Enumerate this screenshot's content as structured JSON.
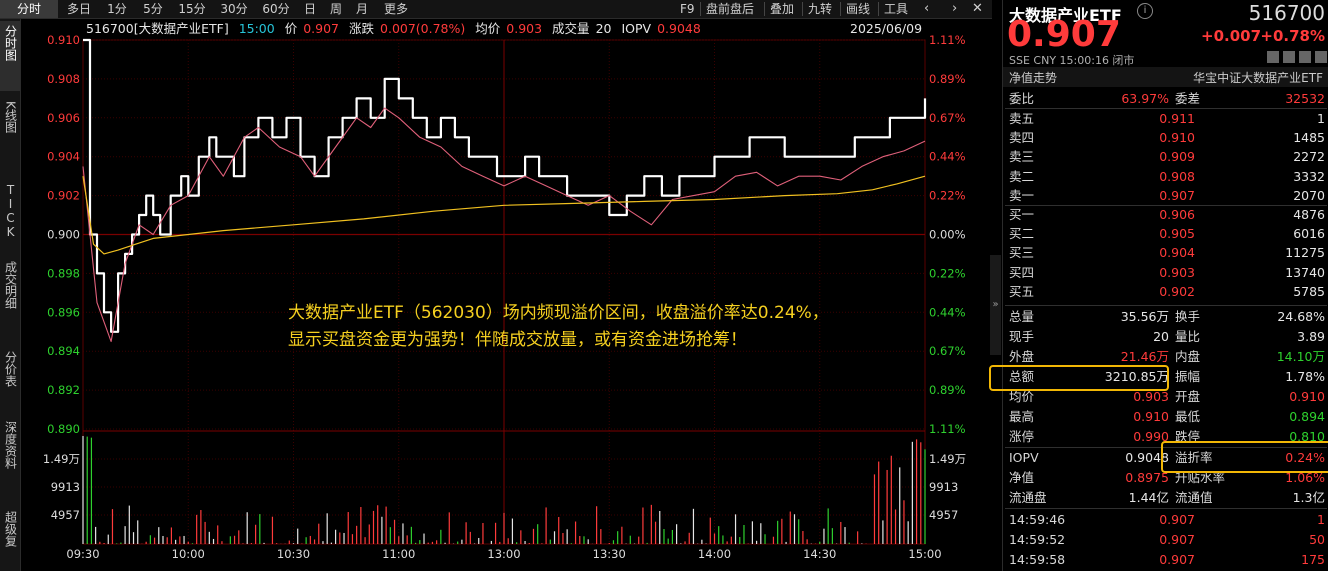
{
  "topbar": {
    "tabs": [
      "分时",
      "多日",
      "1分",
      "5分",
      "15分",
      "30分",
      "60分",
      "日",
      "周",
      "月",
      "更多"
    ],
    "tools": [
      "F9",
      "盘前盘后",
      "叠加",
      "九转",
      "画线",
      "工具"
    ]
  },
  "leftbar": {
    "tabs": [
      "分时图",
      "K线图",
      "TICK",
      "成交明细",
      "分价表",
      "深度资料",
      "超级复"
    ]
  },
  "info": {
    "code_name": "516700[大数据产业ETF]",
    "time": "15:00",
    "price_label": "价",
    "price": "0.907",
    "change_label": "涨跌",
    "change": "0.007(0.78%)",
    "avg_label": "均价",
    "avg": "0.903",
    "vol_label": "成交量",
    "vol": "20",
    "iopv_label": "IOPV",
    "iopv": "0.9048",
    "date": "2025/06/09"
  },
  "annotation": {
    "line1": "大数据产业ETF（562030）场内频现溢价区间，收盘溢价率达0.24%，",
    "line2": "显示买盘资金更为强势！伴随成交放量，或有资金进场抢筹！"
  },
  "chart_data": {
    "type": "line",
    "x_ticks": [
      "09:30",
      "10:00",
      "10:30",
      "11:00",
      "13:00",
      "13:30",
      "14:00",
      "14:30",
      "15:00"
    ],
    "y_ticks": [
      "0.910",
      "0.908",
      "0.906",
      "0.904",
      "0.902",
      "0.900",
      "0.898",
      "0.896",
      "0.894",
      "0.892",
      "0.890"
    ],
    "pct_ticks": [
      "1.11%",
      "0.89%",
      "0.67%",
      "0.44%",
      "0.22%",
      "0.00%",
      "0.22%",
      "0.44%",
      "0.67%",
      "0.89%",
      "1.11%"
    ],
    "ylim": [
      0.89,
      0.91
    ],
    "vol_ticks": [
      "1.49万",
      "9913",
      "4957"
    ],
    "vol_ylim": [
      0,
      20000
    ],
    "colors": {
      "price": "#ffffff",
      "nav": "#e0607a",
      "avg": "#f0c020",
      "up": "#ff3b3b",
      "down": "#2ed12e",
      "grid": "#3a0000"
    },
    "series": [
      {
        "name": "价",
        "x": [
          0,
          2,
          4,
          6,
          8,
          10,
          12,
          14,
          16,
          18,
          20,
          22,
          25,
          28,
          30,
          33,
          36,
          38,
          40,
          43,
          46,
          50,
          54,
          58,
          62,
          66,
          70,
          74,
          78,
          82,
          86,
          90,
          94,
          98,
          102,
          106,
          110,
          114,
          118,
          122,
          126,
          130,
          134,
          138,
          142,
          146,
          150,
          155,
          160,
          165,
          170,
          175,
          180,
          185,
          190,
          195,
          200,
          205,
          210,
          215,
          220,
          225,
          230,
          235,
          240
        ],
        "values": [
          0.91,
          0.9,
          0.898,
          0.896,
          0.895,
          0.898,
          0.899,
          0.9,
          0.901,
          0.902,
          0.901,
          0.9,
          0.902,
          0.903,
          0.902,
          0.904,
          0.905,
          0.904,
          0.904,
          0.903,
          0.905,
          0.906,
          0.905,
          0.906,
          0.904,
          0.903,
          0.905,
          0.906,
          0.907,
          0.906,
          0.908,
          0.907,
          0.906,
          0.905,
          0.906,
          0.905,
          0.904,
          0.904,
          0.903,
          0.903,
          0.904,
          0.903,
          0.903,
          0.902,
          0.902,
          0.902,
          0.901,
          0.902,
          0.903,
          0.902,
          0.903,
          0.903,
          0.904,
          0.904,
          0.905,
          0.905,
          0.904,
          0.904,
          0.904,
          0.904,
          0.905,
          0.905,
          0.906,
          0.906,
          0.907
        ]
      },
      {
        "name": "净值",
        "x": [
          0,
          4,
          8,
          12,
          16,
          20,
          25,
          30,
          36,
          40,
          46,
          50,
          56,
          62,
          66,
          72,
          78,
          82,
          86,
          90,
          96,
          102,
          108,
          114,
          120,
          126,
          132,
          138,
          144,
          150,
          156,
          162,
          168,
          174,
          180,
          186,
          192,
          198,
          204,
          210,
          216,
          222,
          228,
          234,
          240
        ],
        "values": [
          0.9035,
          0.8965,
          0.8945,
          0.8985,
          0.9005,
          0.9,
          0.9015,
          0.902,
          0.904,
          0.903,
          0.905,
          0.9055,
          0.9045,
          0.904,
          0.903,
          0.9045,
          0.906,
          0.9055,
          0.9065,
          0.906,
          0.905,
          0.9045,
          0.9035,
          0.903,
          0.9025,
          0.903,
          0.9025,
          0.902,
          0.9015,
          0.902,
          0.9012,
          0.9005,
          0.9018,
          0.902,
          0.9022,
          0.903,
          0.9032,
          0.9025,
          0.903,
          0.903,
          0.9028,
          0.9035,
          0.904,
          0.9043,
          0.9048
        ]
      },
      {
        "name": "均价",
        "x": [
          0,
          3,
          6,
          10,
          15,
          20,
          30,
          40,
          60,
          80,
          100,
          120,
          140,
          160,
          180,
          200,
          215,
          225,
          232,
          240
        ],
        "values": [
          0.903,
          0.8995,
          0.899,
          0.8992,
          0.8995,
          0.8998,
          0.9,
          0.9002,
          0.9005,
          0.9008,
          0.9012,
          0.9015,
          0.9016,
          0.9017,
          0.9018,
          0.902,
          0.9021,
          0.9023,
          0.9026,
          0.903
        ]
      }
    ]
  },
  "right": {
    "title": "大数据产业ETF",
    "code": "516700",
    "price": "0.907",
    "change": "+0.007",
    "change_pct": "+0.78%",
    "meta": "SSE  CNY  15:00:16  闭市",
    "nav_trend": "净值走势",
    "index": "华宝中证大数据产业ETF",
    "ratio_label": "委比",
    "ratio": "63.97%",
    "diff_label": "委差",
    "diff": "32532",
    "sells": [
      {
        "label": "卖五",
        "price": "0.911",
        "qty": "1"
      },
      {
        "label": "卖四",
        "price": "0.910",
        "qty": "1485"
      },
      {
        "label": "卖三",
        "price": "0.909",
        "qty": "2272"
      },
      {
        "label": "卖二",
        "price": "0.908",
        "qty": "3332"
      },
      {
        "label": "卖一",
        "price": "0.907",
        "qty": "2070"
      }
    ],
    "buys": [
      {
        "label": "买一",
        "price": "0.906",
        "qty": "4876"
      },
      {
        "label": "买二",
        "price": "0.905",
        "qty": "6016"
      },
      {
        "label": "买三",
        "price": "0.904",
        "qty": "11275"
      },
      {
        "label": "买四",
        "price": "0.903",
        "qty": "13740"
      },
      {
        "label": "买五",
        "price": "0.902",
        "qty": "5785"
      }
    ],
    "stats": [
      {
        "l1": "总量",
        "v1": "35.56万",
        "c1": "white",
        "l2": "换手",
        "v2": "24.68%",
        "c2": "white"
      },
      {
        "l1": "现手",
        "v1": "20",
        "c1": "white",
        "l2": "量比",
        "v2": "3.89",
        "c2": "white"
      },
      {
        "l1": "外盘",
        "v1": "21.46万",
        "c1": "red",
        "l2": "内盘",
        "v2": "14.10万",
        "c2": "green"
      },
      {
        "l1": "总额",
        "v1": "3210.85万",
        "c1": "white",
        "l2": "振幅",
        "v2": "1.78%",
        "c2": "white"
      },
      {
        "l1": "均价",
        "v1": "0.903",
        "c1": "red",
        "l2": "开盘",
        "v2": "0.910",
        "c2": "red"
      },
      {
        "l1": "最高",
        "v1": "0.910",
        "c1": "red",
        "l2": "最低",
        "v2": "0.894",
        "c2": "green"
      },
      {
        "l1": "涨停",
        "v1": "0.990",
        "c1": "red",
        "l2": "跌停",
        "v2": "0.810",
        "c2": "green"
      }
    ],
    "stats2": [
      {
        "l1": "IOPV",
        "v1": "0.9048",
        "c1": "white",
        "l2": "溢折率",
        "v2": "0.24%",
        "c2": "red"
      },
      {
        "l1": "净值",
        "v1": "0.8975",
        "c1": "red",
        "l2": "升贴水率",
        "v2": "1.06%",
        "c2": "red"
      },
      {
        "l1": "流通盘",
        "v1": "1.44亿",
        "c1": "white",
        "l2": "流通值",
        "v2": "1.3亿",
        "c2": "white"
      }
    ],
    "trades": [
      {
        "time": "14:59:46",
        "price": "0.907",
        "qty": "1"
      },
      {
        "time": "14:59:52",
        "price": "0.907",
        "qty": "50"
      },
      {
        "time": "14:59:58",
        "price": "0.907",
        "qty": "175"
      }
    ]
  }
}
